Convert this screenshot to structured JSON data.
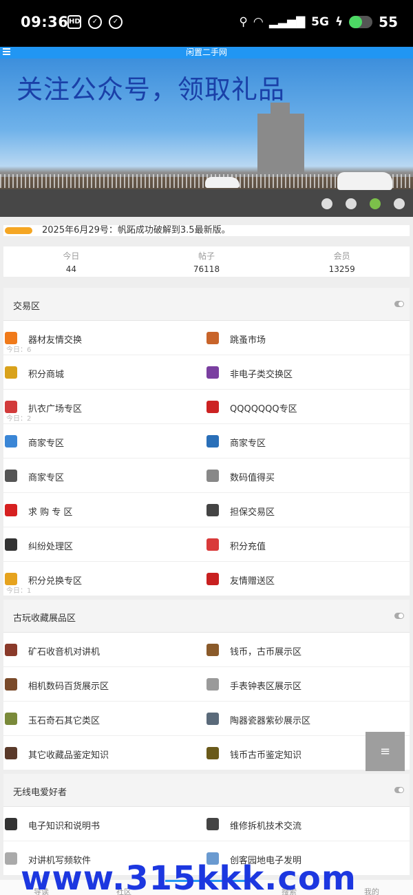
{
  "status_bar": {
    "time": "09:36",
    "left_icons": [
      "hd-icon",
      "check-circle-icon",
      "check-circle-icon"
    ],
    "network": "5G",
    "battery": "55",
    "battery_level": 0.55
  },
  "app": {
    "title": "闲置二手网"
  },
  "banner": {
    "title": "关注公众号，领取礼品",
    "slide_count": 4,
    "active_slide": 3
  },
  "notice": {
    "text": "2025年6月29号：帆跖成功破解到3.5最新版。"
  },
  "stats": [
    {
      "label": "今日",
      "value": "44"
    },
    {
      "label": "帖子",
      "value": "76118"
    },
    {
      "label": "会员",
      "value": "13259"
    }
  ],
  "sections": [
    {
      "title": "交易区",
      "forums": [
        {
          "name": "器材友情交换",
          "icon": "exchange-icon",
          "color": "#f07a1a",
          "today": "今日：6"
        },
        {
          "name": "跳蚤市场",
          "icon": "market-icon",
          "color": "#c8642a",
          "today": ""
        },
        {
          "name": "积分商城",
          "icon": "points-mall-icon",
          "color": "#d9a21b",
          "today": ""
        },
        {
          "name": "非电子类交换区",
          "icon": "grid-icon",
          "color": "#7a3fa0",
          "today": ""
        },
        {
          "name": "扒衣广场专区",
          "icon": "square-icon",
          "color": "#d23b3b",
          "today": "今日：2"
        },
        {
          "name": "QQQQQQQ专区",
          "icon": "shop-icon",
          "color": "#cc2222",
          "today": ""
        },
        {
          "name": "商家专区",
          "icon": "store-icon",
          "color": "#3a86d6",
          "today": ""
        },
        {
          "name": "商家专区",
          "icon": "bag-icon",
          "color": "#2a6fb8",
          "today": ""
        },
        {
          "name": "商家专区",
          "icon": "gear-icon",
          "color": "#555555",
          "today": ""
        },
        {
          "name": "数码值得买",
          "icon": "cart-icon",
          "color": "#888888",
          "today": ""
        },
        {
          "name": "求 购 专 区",
          "icon": "wanted-icon",
          "color": "#d62020",
          "today": ""
        },
        {
          "name": "担保交易区",
          "icon": "guarantee-icon",
          "color": "#444444",
          "today": ""
        },
        {
          "name": "纠纷处理区",
          "icon": "house-icon",
          "color": "#333333",
          "today": ""
        },
        {
          "name": "积分充值",
          "icon": "recharge-icon",
          "color": "#d93a3a",
          "today": ""
        },
        {
          "name": "积分兑换专区",
          "icon": "redeem-icon",
          "color": "#e6a31e",
          "today": "今日：1"
        },
        {
          "name": "友情赠送区",
          "icon": "gift-icon",
          "color": "#c82020",
          "today": ""
        }
      ]
    },
    {
      "title": "古玩收藏展品区",
      "forums": [
        {
          "name": "矿石收音机对讲机",
          "icon": "radio-icon",
          "color": "#8a3a2a",
          "today": ""
        },
        {
          "name": "钱币，古币展示区",
          "icon": "coin-icon",
          "color": "#8a5a2a",
          "today": ""
        },
        {
          "name": "相机数码百货展示区",
          "icon": "camera-icon",
          "color": "#7a4a2a",
          "today": ""
        },
        {
          "name": "手表钟表区展示区",
          "icon": "watch-icon",
          "color": "#9a9a9a",
          "today": ""
        },
        {
          "name": "玉石奇石其它类区",
          "icon": "jade-icon",
          "color": "#7a8a3a",
          "today": ""
        },
        {
          "name": "陶器瓷器紫砂展示区",
          "icon": "pottery-icon",
          "color": "#5a6a7a",
          "today": ""
        },
        {
          "name": "其它收藏品鉴定知识",
          "icon": "collection-icon",
          "color": "#5a3a2a",
          "today": ""
        },
        {
          "name": "钱币古币鉴定知识",
          "icon": "ancient-coin-icon",
          "color": "#6a5a1a",
          "today": ""
        }
      ]
    },
    {
      "title": "无线电爱好者",
      "forums": [
        {
          "name": "电子知识和说明书",
          "icon": "circuit-icon",
          "color": "#333333",
          "today": ""
        },
        {
          "name": "维修拆机技术交流",
          "icon": "tools-icon",
          "color": "#444444",
          "today": ""
        },
        {
          "name": "对讲机写频软件",
          "icon": "software-icon",
          "color": "#aaaaaa",
          "today": ""
        },
        {
          "name": "创客园地电子发明",
          "icon": "maker-icon",
          "color": "#6a9ad0",
          "today": ""
        }
      ]
    }
  ],
  "float_button": {
    "label": "≡"
  },
  "watermark": {
    "text": "www.315kkk.com"
  },
  "bottom_nav": [
    {
      "label": "导读"
    },
    {
      "label": "社区"
    },
    {
      "label": ""
    },
    {
      "label": "搜索"
    },
    {
      "label": "我的"
    }
  ]
}
